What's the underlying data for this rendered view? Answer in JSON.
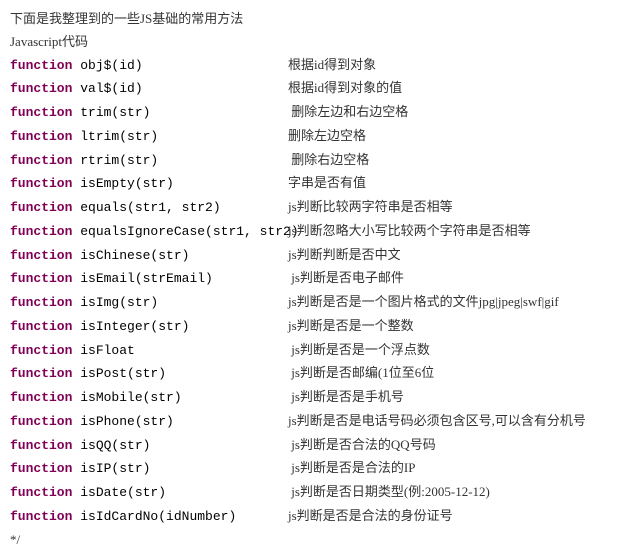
{
  "intro": "下面是我整理到的一些JS基础的常用方法",
  "lang_label": "Javascript代码",
  "keyword": "function",
  "end_comment": "*/",
  "rows": [
    {
      "fn": "obj$(id)",
      "desc": "根据id得到对象"
    },
    {
      "fn": "val$(id)",
      "desc": "根据id得到对象的值"
    },
    {
      "fn": "trim(str)",
      "desc": " 删除左边和右边空格"
    },
    {
      "fn": "ltrim(str)",
      "desc": "删除左边空格"
    },
    {
      "fn": "rtrim(str)",
      "desc": " 删除右边空格"
    },
    {
      "fn": "isEmpty(str)",
      "desc": "字串是否有值"
    },
    {
      "fn": "equals(str1, str2)",
      "desc": "js判断比较两字符串是否相等"
    },
    {
      "fn": "equalsIgnoreCase(str1, str2)",
      "desc": "js判断忽略大小写比较两个字符串是否相等"
    },
    {
      "fn": "isChinese(str)",
      "desc": "js判断判断是否中文"
    },
    {
      "fn": "isEmail(strEmail)",
      "desc": " js判断是否电子邮件"
    },
    {
      "fn": "isImg(str)",
      "desc": "js判断是否是一个图片格式的文件jpg|jpeg|swf|gif"
    },
    {
      "fn": "isInteger(str)",
      "desc": "js判断是否是一个整数"
    },
    {
      "fn": "isFloat",
      "desc": " js判断是否是一个浮点数"
    },
    {
      "fn": "isPost(str)",
      "desc": " js判断是否邮编(1位至6位"
    },
    {
      "fn": "isMobile(str)",
      "desc": " js判断是否是手机号"
    },
    {
      "fn": "isPhone(str)",
      "desc": "js判断是否是电话号码必须包含区号,可以含有分机号"
    },
    {
      "fn": "isQQ(str)",
      "desc": " js判断是否合法的QQ号码"
    },
    {
      "fn": "isIP(str)",
      "desc": " js判断是否是合法的IP"
    },
    {
      "fn": "isDate(str)",
      "desc": " js判断是否日期类型(例:2005-12-12)"
    },
    {
      "fn": "isIdCardNo(idNumber)",
      "desc": "js判断是否是合法的身份证号"
    }
  ]
}
